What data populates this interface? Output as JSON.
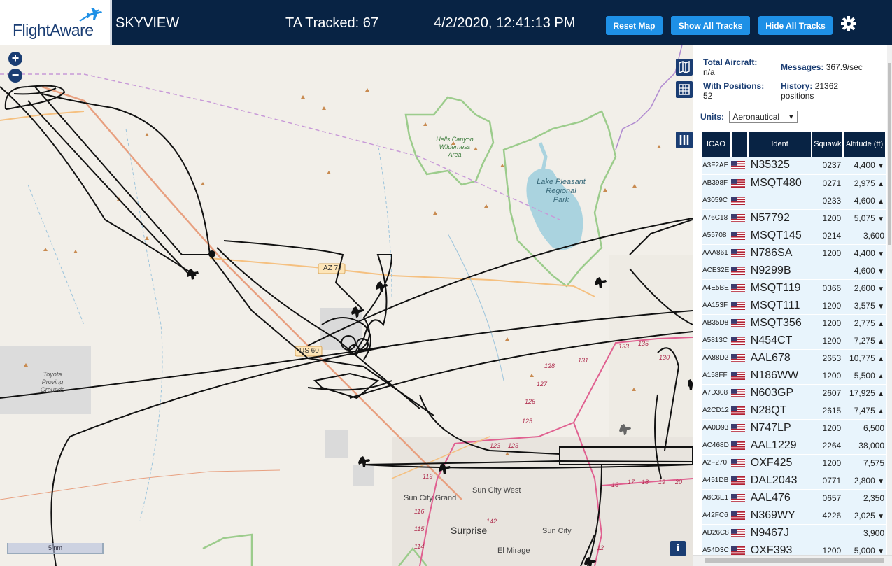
{
  "header": {
    "logo": "FlightAware",
    "title": "SKYVIEW",
    "ta_tracked": "TA Tracked: 67",
    "clock": "4/2/2020, 12:41:13 PM",
    "reset_map": "Reset Map",
    "show_all_tracks": "Show All Tracks",
    "hide_all_tracks": "Hide All Tracks"
  },
  "map": {
    "zoom_in": "+",
    "zoom_out": "−",
    "scale": "5 nm",
    "info": "i",
    "labels": {
      "hells_canyon": [
        "Hells Canyon",
        "Wilderness",
        "Area"
      ],
      "lake_pleasant": [
        "Lake Pleasant",
        "Regional",
        "Park"
      ],
      "toyota": [
        "Toyota",
        "Proving",
        "Grounds"
      ],
      "az74": "AZ 74",
      "us60": "US 60",
      "sun_city_grand": "Sun City Grand",
      "sun_city_west": "Sun City West",
      "sun_city": "Sun City",
      "surprise": "Surprise",
      "el_mirage": "El Mirage",
      "route_nums": [
        "128",
        "127",
        "126",
        "125",
        "123",
        "123",
        "119",
        "116",
        "115",
        "114",
        "142",
        "131",
        "133",
        "135",
        "130",
        "17",
        "18",
        "19",
        "20",
        "16",
        "12"
      ]
    }
  },
  "panel": {
    "total_aircraft_label": "Total Aircraft:",
    "total_aircraft_value": "n/a",
    "with_positions_label": "With Positions:",
    "with_positions_value": "52",
    "messages_label": "Messages:",
    "messages_value": "367.9/sec",
    "history_label": "History:",
    "history_value": "21362",
    "history_unit": "positions",
    "units_label": "Units:",
    "units_value": "Aeronautical",
    "columns": [
      "ICAO",
      "",
      "Ident",
      "Squawk",
      "Altitude (ft)"
    ],
    "rows": [
      {
        "icao": "A3F2AE",
        "ident": "N35325",
        "squawk": "0237",
        "alt": "4,400",
        "trend": "▼"
      },
      {
        "icao": "AB398F",
        "ident": "MSQT480",
        "squawk": "0271",
        "alt": "2,975",
        "trend": "▲"
      },
      {
        "icao": "A3059C",
        "ident": "",
        "squawk": "0233",
        "alt": "4,600",
        "trend": "▲"
      },
      {
        "icao": "A76C18",
        "ident": "N57792",
        "squawk": "1200",
        "alt": "5,075",
        "trend": "▼"
      },
      {
        "icao": "A55708",
        "ident": "MSQT145",
        "squawk": "0214",
        "alt": "3,600",
        "trend": ""
      },
      {
        "icao": "AAA861",
        "ident": "N786SA",
        "squawk": "1200",
        "alt": "4,400",
        "trend": "▼"
      },
      {
        "icao": "ACE32E",
        "ident": "N9299B",
        "squawk": "",
        "alt": "4,600",
        "trend": "▼"
      },
      {
        "icao": "A4E5BE",
        "ident": "MSQT119",
        "squawk": "0366",
        "alt": "2,600",
        "trend": "▼"
      },
      {
        "icao": "AA153F",
        "ident": "MSQT111",
        "squawk": "1200",
        "alt": "3,575",
        "trend": "▼"
      },
      {
        "icao": "AB35D8",
        "ident": "MSQT356",
        "squawk": "1200",
        "alt": "2,775",
        "trend": "▲"
      },
      {
        "icao": "A5813C",
        "ident": "N454CT",
        "squawk": "1200",
        "alt": "7,275",
        "trend": "▲"
      },
      {
        "icao": "AA88D2",
        "ident": "AAL678",
        "squawk": "2653",
        "alt": "10,775",
        "trend": "▲"
      },
      {
        "icao": "A158FF",
        "ident": "N186WW",
        "squawk": "1200",
        "alt": "5,500",
        "trend": "▲"
      },
      {
        "icao": "A7D308",
        "ident": "N603GP",
        "squawk": "2607",
        "alt": "17,925",
        "trend": "▲"
      },
      {
        "icao": "A2CD12",
        "ident": "N28QT",
        "squawk": "2615",
        "alt": "7,475",
        "trend": "▲"
      },
      {
        "icao": "AA0D93",
        "ident": "N747LP",
        "squawk": "1200",
        "alt": "6,500",
        "trend": ""
      },
      {
        "icao": "AC468D",
        "ident": "AAL1229",
        "squawk": "2264",
        "alt": "38,000",
        "trend": ""
      },
      {
        "icao": "A2F270",
        "ident": "OXF425",
        "squawk": "1200",
        "alt": "7,575",
        "trend": ""
      },
      {
        "icao": "A451DB",
        "ident": "DAL2043",
        "squawk": "0771",
        "alt": "2,800",
        "trend": "▼"
      },
      {
        "icao": "A8C6E1",
        "ident": "AAL476",
        "squawk": "0657",
        "alt": "2,350",
        "trend": ""
      },
      {
        "icao": "A42FC6",
        "ident": "N369WY",
        "squawk": "4226",
        "alt": "2,025",
        "trend": "▼"
      },
      {
        "icao": "AD26C8",
        "ident": "N9467J",
        "squawk": "",
        "alt": "3,900",
        "trend": ""
      },
      {
        "icao": "A54D3C",
        "ident": "OXF393",
        "squawk": "1200",
        "alt": "5,000",
        "trend": "▼"
      }
    ]
  },
  "colors": {
    "header_bg": "#082344",
    "button_blue": "#1e90e6",
    "row_bg": "#e8f4fc",
    "map_bg": "#f2efe9",
    "water": "#aad3df",
    "park_border": "#9ccc8c"
  }
}
